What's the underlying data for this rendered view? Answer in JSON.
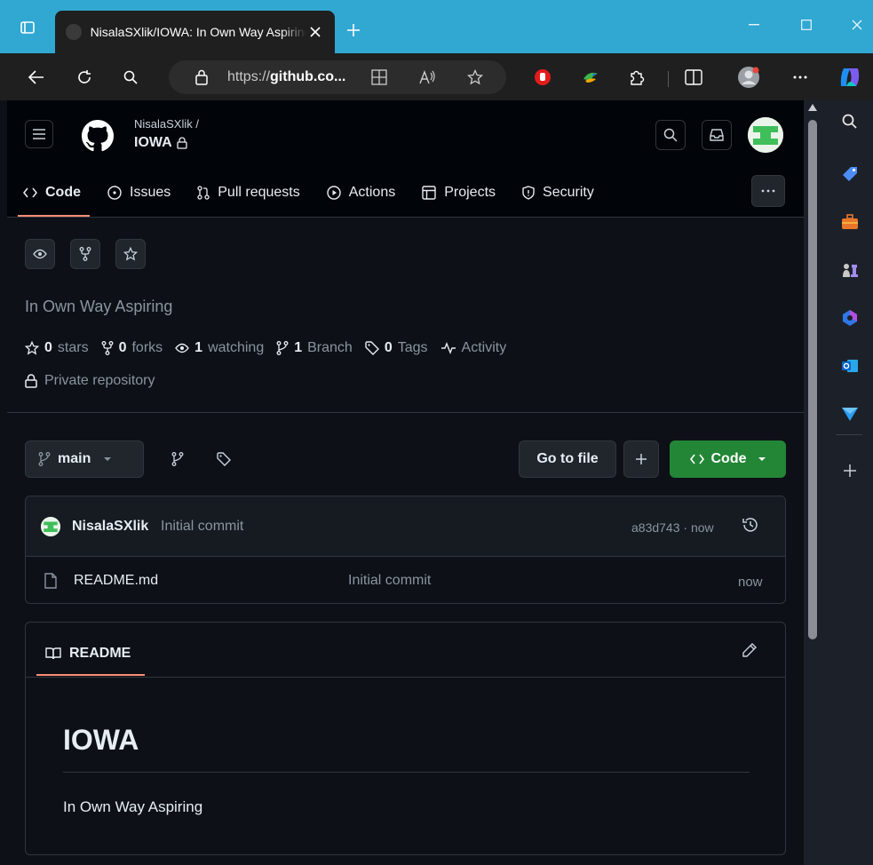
{
  "browser": {
    "tab_title": "NisalaSXlik/IOWA: In Own Way Aspiring",
    "url_prefix": "https://",
    "url_host": "github.co...",
    "colors": {
      "titlebar": "#30a8d2",
      "toolbar": "#1f1f1f"
    }
  },
  "repo": {
    "owner": "NisalaSXlik /",
    "name": "IOWA",
    "description": "In Own Way Aspiring",
    "visibility": "Private repository"
  },
  "nav": {
    "items": [
      "Code",
      "Issues",
      "Pull requests",
      "Actions",
      "Projects",
      "Security"
    ]
  },
  "stats": {
    "stars_count": "0",
    "stars_label": "stars",
    "forks_count": "0",
    "forks_label": "forks",
    "watching_count": "1",
    "watching_label": "watching",
    "branch_count": "1",
    "branch_label": "Branch",
    "tags_count": "0",
    "tags_label": "Tags",
    "activity_label": "Activity"
  },
  "actions": {
    "branch": "main",
    "go_to_file": "Go to file",
    "code_button": "Code",
    "accent_green": "#238636"
  },
  "latest_commit": {
    "author": "NisalaSXlik",
    "message": "Initial commit",
    "meta": "a83d743 · now"
  },
  "files": [
    {
      "name": "README.md",
      "commit": "Initial commit",
      "age": "now"
    }
  ],
  "readme": {
    "tab_label": "README",
    "heading": "IOWA",
    "body": "In Own Way Aspiring",
    "accent": "#fd8c73"
  }
}
